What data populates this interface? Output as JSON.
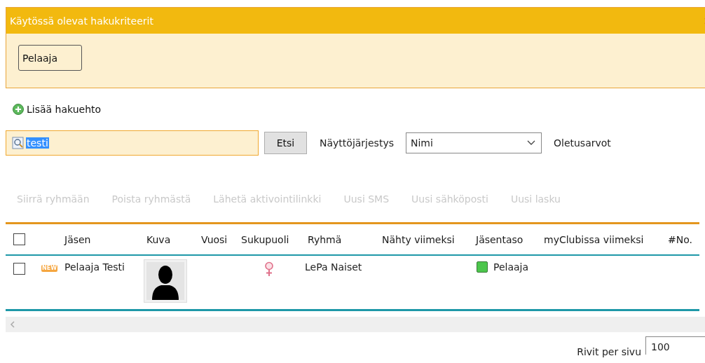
{
  "criteria_panel": {
    "title": "Käytössä olevat hakukriteerit",
    "chips": [
      "Pelaaja"
    ]
  },
  "add_criterion": "Lisää hakuehto",
  "search": {
    "value": "testi",
    "button": "Etsi",
    "sort_label": "Näyttöjärjestys",
    "sort_value": "Nimi",
    "defaults_link": "Oletusarvot"
  },
  "actions": [
    {
      "label": "Siirrä ryhmään",
      "disabled": true
    },
    {
      "label": "Poista ryhmästä",
      "disabled": true
    },
    {
      "label": "Lähetä aktivointilinkki",
      "disabled": true
    },
    {
      "label": "Uusi SMS",
      "disabled": true
    },
    {
      "label": "Uusi sähköposti",
      "disabled": true
    },
    {
      "label": "Uusi lasku",
      "disabled": true
    }
  ],
  "table": {
    "select_all_checked": false,
    "columns": [
      "Jäsen",
      "Kuva",
      "Vuosi",
      "Sukupuoli",
      "Ryhmä",
      "Nähty viimeksi",
      "Jäsentaso",
      "myClubissa viimeksi",
      "#No."
    ],
    "rows": [
      {
        "checked": false,
        "badge": "NEW",
        "name": "Pelaaja Testi",
        "gender": {
          "kind": "female"
        },
        "group": "LePa Naiset",
        "level": {
          "label": "Pelaaja",
          "color": "#4cc64c"
        }
      }
    ]
  },
  "pagination": {
    "label": "Rivit per sivu",
    "value": "100"
  }
}
